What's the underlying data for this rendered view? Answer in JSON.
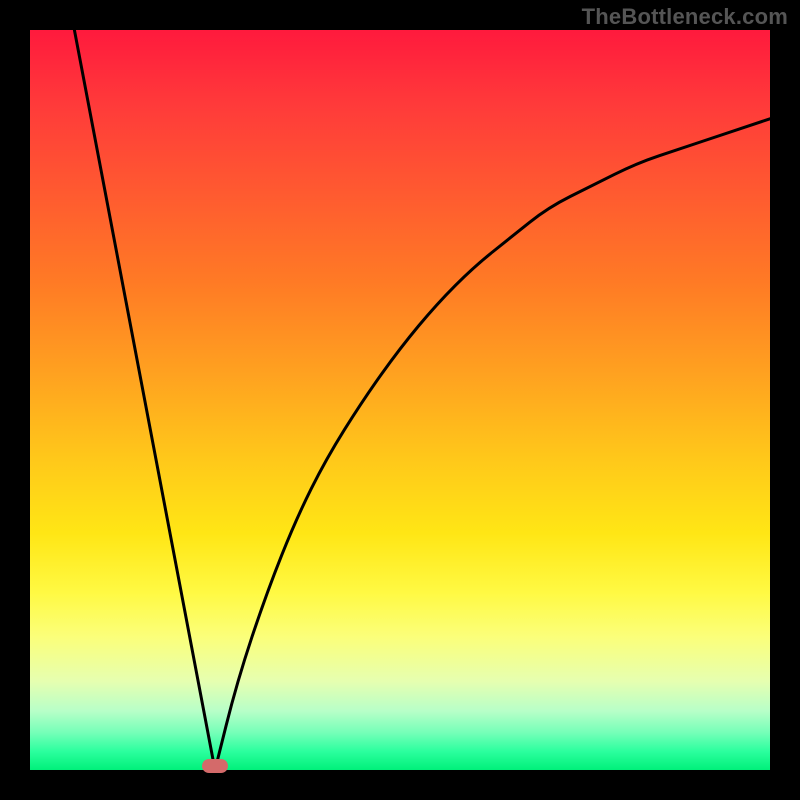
{
  "attribution": "TheBottleneck.com",
  "chart_data": {
    "type": "line",
    "title": "",
    "xlabel": "",
    "ylabel": "",
    "xlim": [
      0,
      100
    ],
    "ylim": [
      0,
      100
    ],
    "grid": false,
    "legend": false,
    "series": [
      {
        "name": "left-descending-line",
        "x": [
          6,
          25
        ],
        "y": [
          100,
          0
        ]
      },
      {
        "name": "right-rising-curve",
        "x": [
          25,
          28,
          32,
          36,
          40,
          45,
          50,
          55,
          60,
          65,
          70,
          76,
          82,
          88,
          94,
          100
        ],
        "y": [
          0,
          12,
          24,
          34,
          42,
          50,
          57,
          63,
          68,
          72,
          76,
          79,
          82,
          84,
          86,
          88
        ]
      }
    ],
    "marker": {
      "x": 25,
      "y": 0
    },
    "background_gradient": {
      "top_color": "#ff1a3d",
      "bottom_color": "#00f07a"
    }
  }
}
